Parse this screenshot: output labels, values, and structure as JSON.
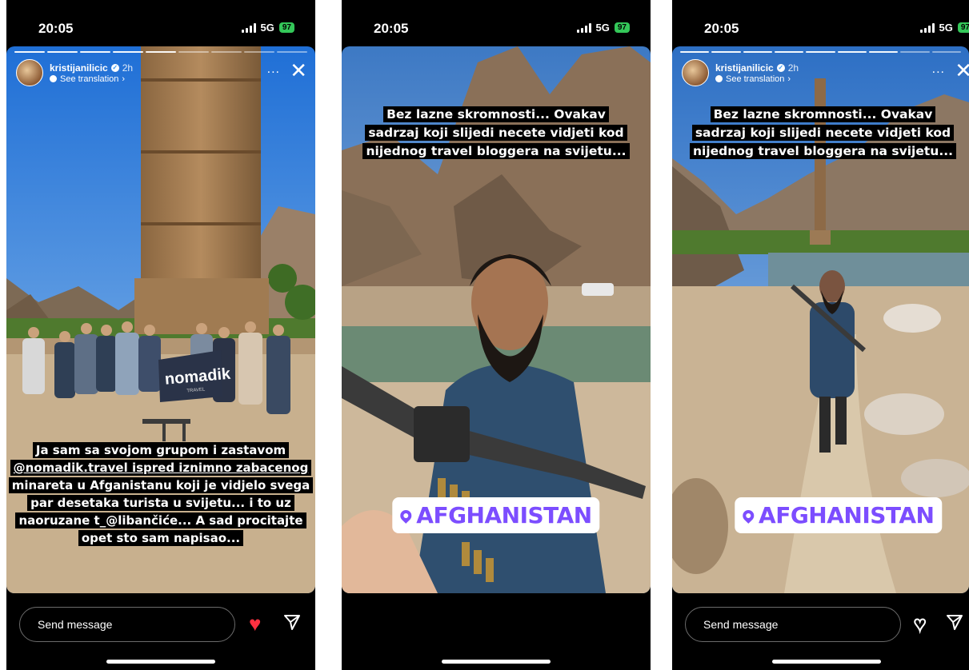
{
  "status_bar": {
    "time": "20:05",
    "network": "5G",
    "battery": "97"
  },
  "story_header": {
    "username": "kristijanilicic",
    "time_ago": "2h",
    "translate_label": "See translation",
    "more_label": "...",
    "close_label": "✕"
  },
  "screens": [
    {
      "caption_lines": [
        "Ja sam sa svojom grupom i zastavom",
        "@nomadik.travel ispred iznimno zabacenog",
        "minareta u Afganistanu koji je vidjelo svega",
        "par desetaka turista u svijetu...  i to uz",
        "naoruzane t_@libančiće... A sad procitajte",
        "opet sto sam napisao..."
      ],
      "banner_text": "nomadik",
      "banner_sub": "TRAVEL",
      "message_placeholder": "Send message",
      "liked": true
    },
    {
      "caption_lines": [
        "Bez lazne skromnosti... Ovakav",
        "sadrzaj koji slijedi necete vidjeti kod",
        "nijednog travel bloggera na svijetu..."
      ],
      "location": "AFGHANISTAN"
    },
    {
      "caption_lines": [
        "Bez lazne skromnosti... Ovakav",
        "sadrzaj koji slijedi necete vidjeti kod",
        "nijednog travel bloggera na svijetu..."
      ],
      "location": "AFGHANISTAN",
      "message_placeholder": "Send message",
      "liked": false
    }
  ],
  "colors": {
    "location_accent": "#7c4dff",
    "like_red": "#ff3040",
    "battery_green": "#34c759"
  },
  "icons": [
    "signal-icon",
    "battery-icon",
    "verified-icon",
    "translate-icon",
    "more-icon",
    "close-icon",
    "heart-icon",
    "send-icon",
    "location-pin-icon"
  ]
}
